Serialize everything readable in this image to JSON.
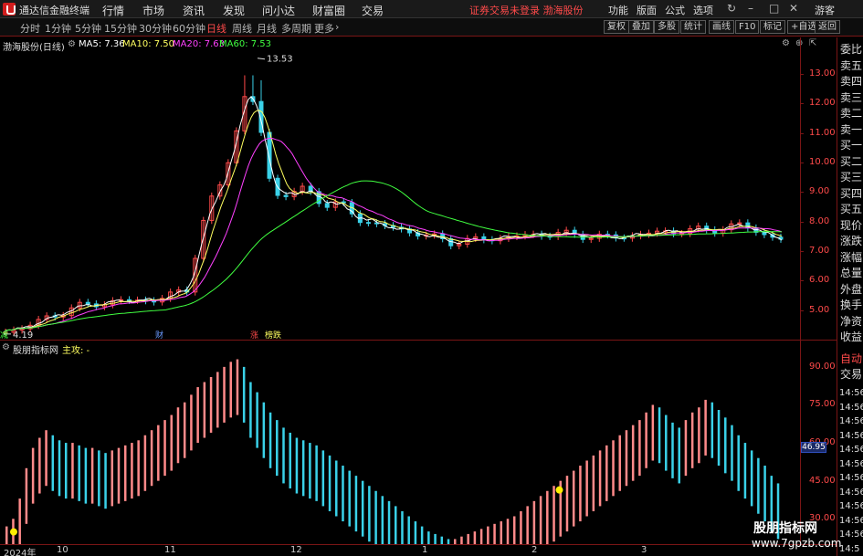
{
  "titlebar": {
    "app_title": "通达信金融终端",
    "menus": [
      "行情",
      "市场",
      "资讯",
      "发现",
      "问小达",
      "财富圈",
      "交易"
    ],
    "warning": "证券交易未登录  渤海股份",
    "right_menus": [
      "功能",
      "版面",
      "公式",
      "选项"
    ],
    "guest": "游客"
  },
  "toolbar": {
    "periods": [
      "分时",
      "1分钟",
      "5分钟",
      "15分钟",
      "30分钟",
      "60分钟",
      "日线",
      "周线",
      "月线",
      "多周期",
      "更多"
    ],
    "active_period": "日线",
    "buttons": [
      "复权",
      "叠加",
      "多股",
      "统计",
      "画线",
      "F10",
      "标记",
      "+自选",
      "返回"
    ]
  },
  "main_chart": {
    "stock_label": "渤海股份(日线)",
    "ma5": "MA5: 7.36",
    "ma10": "MA10: 7.50",
    "ma20": "MA20: 7.63",
    "ma60": "MA60: 7.53",
    "high_label": "13.53",
    "low_label": "4.19",
    "y_ticks": [
      "13.00",
      "12.00",
      "11.00",
      "10.00",
      "9.00",
      "8.00",
      "7.00",
      "6.00",
      "5.00"
    ],
    "markers": [
      "减",
      "财",
      "涨",
      "榜跌"
    ]
  },
  "indicator": {
    "name": "股朋指标网",
    "subtitle": "主攻: -",
    "y_ticks": [
      "90.00",
      "75.00",
      "60.00",
      "45.00",
      "30.00"
    ],
    "cursor_value": "46.95"
  },
  "right_panel": {
    "labels": [
      "委比",
      "卖五",
      "卖四",
      "卖三",
      "卖二",
      "卖一",
      "买一",
      "买二",
      "买三",
      "买四",
      "买五",
      "现价",
      "涨跌",
      "涨幅",
      "总量",
      "外盘",
      "换手",
      "净资",
      "收益"
    ],
    "lower_labels": [
      "自动",
      "交易"
    ],
    "times": [
      "14:56",
      "14:56",
      "14:56",
      "14:56",
      "14:56",
      "14:56",
      "14:56",
      "14:56",
      "14:56",
      "14:56",
      "14:56",
      "14:5"
    ]
  },
  "x_axis": [
    "2024年",
    "10",
    "11",
    "12",
    "1",
    "2",
    "3"
  ],
  "watermark": {
    "line1": "股朋指标网",
    "line2": "www.7gpzb.com"
  },
  "colors": {
    "up": "#ff4a4a",
    "down": "#3ad1e8",
    "ma5": "#ffffff",
    "ma10": "#ffff60",
    "ma20": "#ff40ff",
    "ma60": "#40ff40",
    "border": "#7a1515"
  },
  "chart_data": [
    {
      "type": "candlestick",
      "title": "渤海股份(日线)",
      "ylim": [
        4.0,
        13.8
      ],
      "y_ticks": [
        5,
        6,
        7,
        8,
        9,
        10,
        11,
        12,
        13
      ],
      "x": [
        "2024年",
        "10",
        "11",
        "12",
        "1",
        "2",
        "3"
      ],
      "high": 13.53,
      "low": 4.19,
      "series": [
        {
          "name": "MA5",
          "last": 7.36
        },
        {
          "name": "MA10",
          "last": 7.5
        },
        {
          "name": "MA20",
          "last": 7.63
        },
        {
          "name": "MA60",
          "last": 7.53
        }
      ]
    },
    {
      "type": "bar",
      "title": "股朋指标网",
      "ylim": [
        20,
        95
      ],
      "y_ticks": [
        30,
        45,
        60,
        75,
        90
      ],
      "values": [
        27,
        30,
        38,
        50,
        58,
        62,
        65,
        63,
        61,
        60,
        60,
        59,
        58,
        58,
        57,
        56,
        57,
        58,
        59,
        60,
        61,
        63,
        65,
        67,
        69,
        71,
        74,
        76,
        79,
        82,
        84,
        86,
        88,
        90,
        92,
        93,
        90,
        84,
        80,
        76,
        72,
        69,
        66,
        64,
        62,
        61,
        60,
        59,
        57,
        55,
        53,
        51,
        49,
        47,
        45,
        43,
        41,
        39,
        37,
        35,
        33,
        31,
        29,
        27,
        25,
        24,
        23,
        22,
        22,
        23,
        24,
        25,
        26,
        27,
        28,
        29,
        30,
        31,
        33,
        35,
        37,
        39,
        41,
        43,
        45,
        47,
        49,
        51,
        53,
        55,
        57,
        59,
        61,
        63,
        65,
        67,
        69,
        72,
        75,
        74,
        71,
        68,
        66,
        69,
        72,
        74,
        77,
        76,
        73,
        70,
        67,
        63,
        60,
        57,
        54,
        51,
        47,
        44
      ]
    }
  ]
}
